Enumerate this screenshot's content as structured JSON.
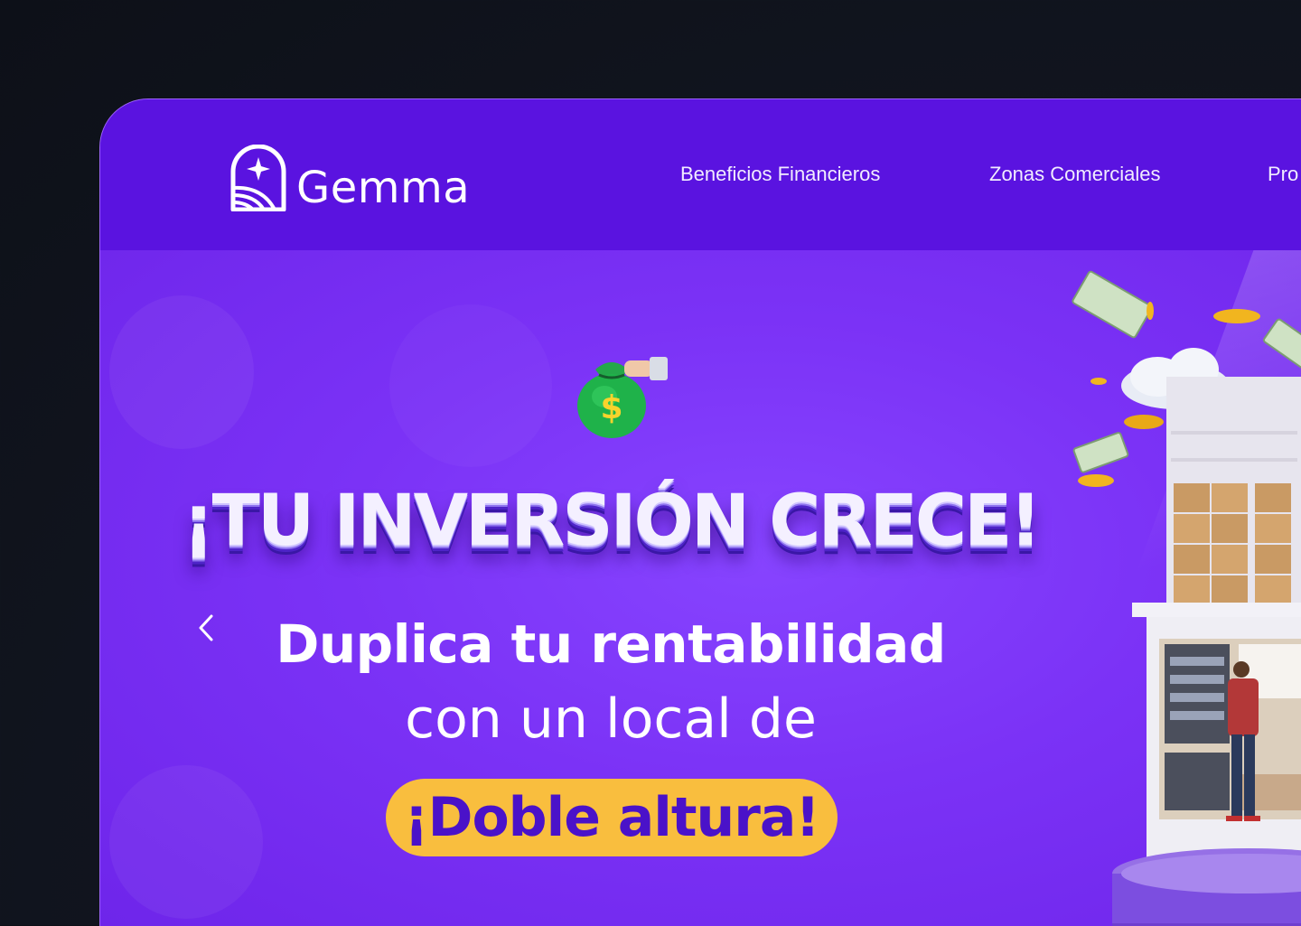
{
  "brand": {
    "name": "Gemma"
  },
  "nav": {
    "items": [
      {
        "label": "Beneficios Financieros"
      },
      {
        "label": "Zonas Comerciales"
      },
      {
        "label": "Pro"
      }
    ]
  },
  "hero": {
    "headline": "¡TU INVERSIÓN CRECE!",
    "line1": "Duplica tu rentabilidad",
    "line2": "con un local de",
    "highlight": "¡Doble altura!",
    "money_bag_symbol": "$"
  },
  "icons": {
    "logo": "gemma-arch-star-logo",
    "prev": "chevron-left-icon",
    "bag": "money-bag-icon"
  },
  "colors": {
    "nav_bg": "#5a13e0",
    "hero_bg": "#7b32f6",
    "pill_bg": "#f9be3e",
    "pill_text": "#4a12c9",
    "page_bg": "#0d1018"
  }
}
